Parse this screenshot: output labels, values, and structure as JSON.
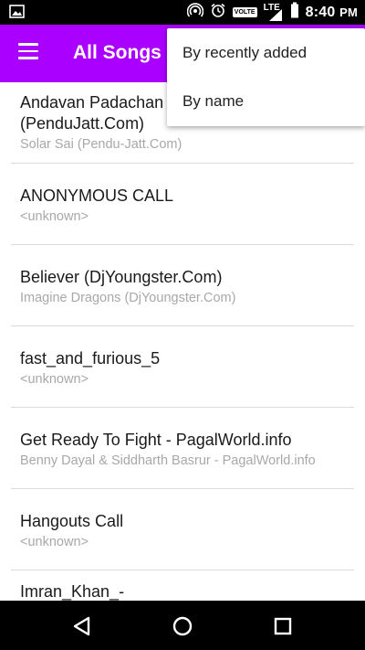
{
  "status_bar": {
    "time": "8:40",
    "ampm": "PM",
    "volte": "VOLTE",
    "network": "LTE",
    "icons": [
      "image-icon",
      "hotspot-icon",
      "alarm-icon",
      "volte-icon",
      "lte-signal-icon",
      "battery-icon"
    ]
  },
  "app_bar": {
    "title": "All Songs",
    "background": "#aa00ff",
    "menu_icon": "hamburger-menu-icon"
  },
  "sort_menu": {
    "options": [
      {
        "label": "By recently added"
      },
      {
        "label": "By name"
      }
    ]
  },
  "songs": [
    {
      "title_line1": "Andavan Padachan",
      "title_line2": "(PenduJatt.Com)",
      "artist": "Solar Sai (Pendu-Jatt.Com)"
    },
    {
      "title": "ANONYMOUS CALL",
      "artist": "<unknown>"
    },
    {
      "title": "Believer (DjYoungster.Com)",
      "artist": "Imagine Dragons (DjYoungster.Com)"
    },
    {
      "title": "fast_and_furious_5",
      "artist": "<unknown>"
    },
    {
      "title": "Get Ready To Fight - PagalWorld.info",
      "artist": "Benny Dayal & Siddharth Basrur - PagalWorld.info"
    },
    {
      "title": "Hangouts Call",
      "artist": "<unknown>"
    },
    {
      "title": "Imran_Khan_-",
      "artist": ""
    }
  ],
  "nav_bar": {
    "icons": [
      "back-icon",
      "home-icon",
      "recents-icon"
    ]
  }
}
